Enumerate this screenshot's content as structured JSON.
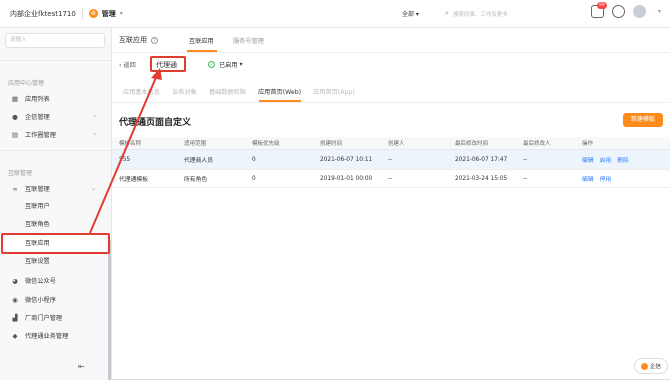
{
  "topbar": {
    "company": "内部企业fktest1710",
    "manage": "管理",
    "scope": "全部",
    "search_placeholder": "搜索同事、工作及更多",
    "notif_badge": "99"
  },
  "sidebar": {
    "search_placeholder": "请输入",
    "group1": "应用中心管理",
    "items1": [
      {
        "label": "应用列表",
        "icon": "grid-icon"
      },
      {
        "label": "企信管理",
        "icon": "chat-icon"
      },
      {
        "label": "工作圈管理",
        "icon": "doc-icon"
      }
    ],
    "group2": "互联管理",
    "item_interconnect": "互联管理",
    "subitems": [
      "互联用户",
      "互联角色",
      "互联应用",
      "互联设置"
    ],
    "items2": [
      {
        "label": "微信公众号",
        "icon": "wechat-icon"
      },
      {
        "label": "微信小程序",
        "icon": "miniapp-icon"
      },
      {
        "label": "厂商门户管理",
        "icon": "portal-icon"
      },
      {
        "label": "代理通业务管理",
        "icon": "shield-icon"
      }
    ],
    "active_item": "互联应用"
  },
  "main": {
    "page_title": "互联应用",
    "tabs": [
      "互联应用",
      "服务号管理"
    ],
    "back_label": "返回",
    "app_name": "代理通",
    "status": "已启用",
    "subtabs": [
      "应用基本信息",
      "业务对象",
      "基础数据权限",
      "应用首页(Web)",
      "应用首页(App)"
    ],
    "active_subtab": "应用首页(Web)",
    "section_title": "代理通页面自定义",
    "new_button": "新建模板",
    "table": {
      "headers": [
        "模板名称",
        "适用范围",
        "模板优先级",
        "创建时间",
        "创建人",
        "最后修改时间",
        "最后修改人",
        "操作"
      ],
      "rows": [
        {
          "name": "555",
          "scope": "代理商人员",
          "priority": "0",
          "created": "2021-06-07 10:11",
          "creator": "--",
          "modified": "2021-06-07 17:47",
          "modifier": "--",
          "ops": [
            "编辑",
            "启用",
            "删除"
          ]
        },
        {
          "name": "代理通模板",
          "scope": "所有角色",
          "priority": "0",
          "created": "2019-01-01 00:00",
          "creator": "--",
          "modified": "2021-03-24 15:05",
          "modifier": "--",
          "ops": [
            "编辑",
            "停用"
          ]
        }
      ]
    }
  },
  "float_help": "企信",
  "colors": {
    "accent": "#ff8c1a",
    "link": "#2f7cf6",
    "annotation": "#e03c30",
    "enabled": "#3fba5a"
  }
}
